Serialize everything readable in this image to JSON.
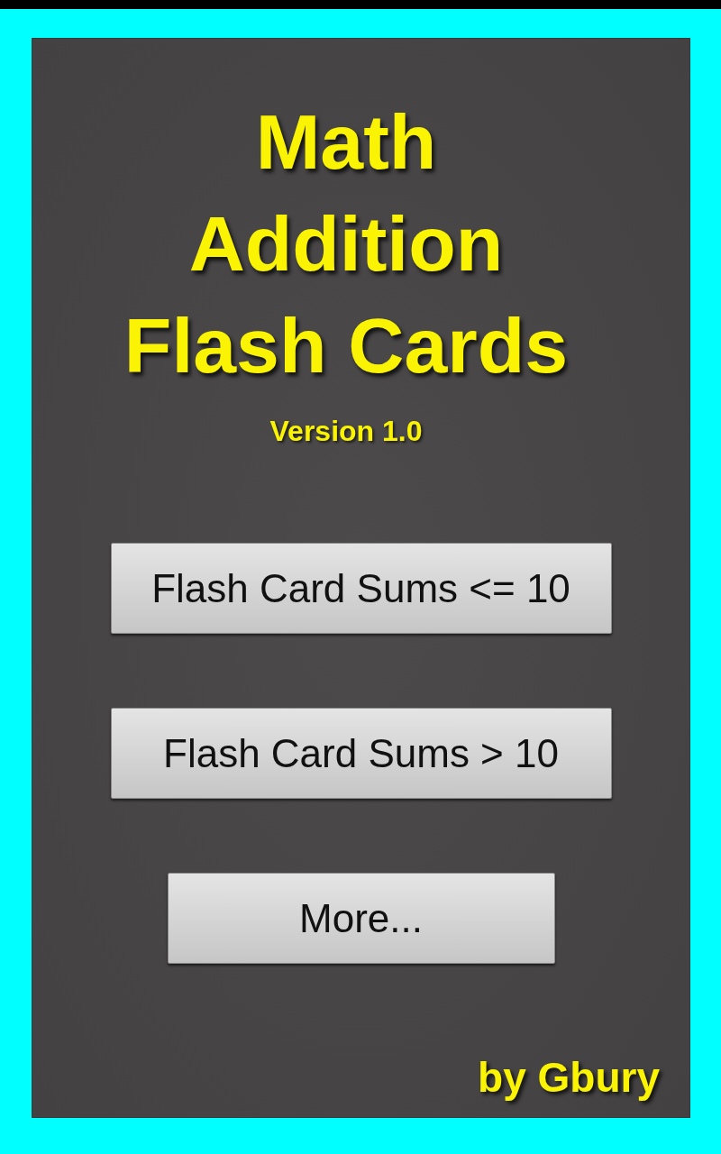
{
  "title": {
    "lines": [
      "Math",
      "Addition",
      "Flash Cards"
    ]
  },
  "version": "Version 1.0",
  "buttons": [
    {
      "label": "Flash Card Sums <= 10",
      "kind": "wide"
    },
    {
      "label": "Flash Card Sums > 10",
      "kind": "wide"
    },
    {
      "label": "More...",
      "kind": "narrow"
    }
  ],
  "author": "by Gbury"
}
